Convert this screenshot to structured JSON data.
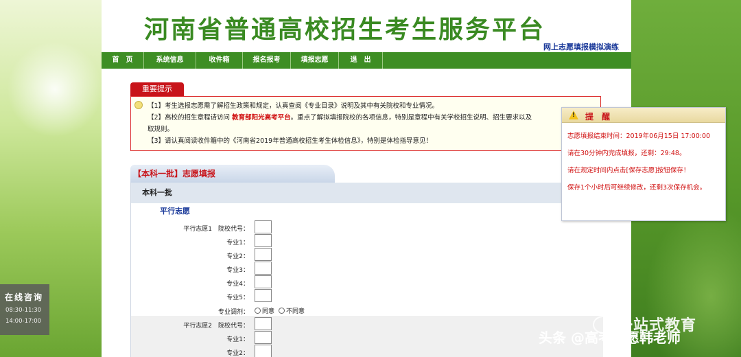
{
  "header": {
    "title": "河南省普通高校招生考生服务平台",
    "subtitle": "网上志愿填报模拟演练"
  },
  "nav": {
    "items": [
      {
        "label": "首　页"
      },
      {
        "label": "系统信息"
      },
      {
        "label": "收件箱"
      },
      {
        "label": "报名报考"
      },
      {
        "label": "填报志愿"
      },
      {
        "label": "退　出"
      }
    ]
  },
  "notice": {
    "tab_label": "重要提示",
    "line1": "【1】考生选报志愿需了解招生政策和规定，认真查阅《专业目录》说明及其中有关院校和专业情况。",
    "line2_pre": "【2】高校的招生章程请访问",
    "line2_link": "教育部阳光高考平台",
    "line2_post": "。重点了解拟填报院校的各项信息，特别是章程中有关学校招生说明、招生要求以及",
    "line2_cont": "取规则。",
    "line3": "【3】请认真阅读收件箱中的《河南省2019年普通高校招生考生体检信息》，特别是体检指导意见！"
  },
  "form": {
    "tab_label": "【本科一批】志愿填报",
    "category": "本科一批",
    "section": "平行志愿",
    "group1": {
      "school_label": "平行志愿1　院校代号：",
      "majors": [
        "专业1：",
        "专业2：",
        "专业3：",
        "专业4：",
        "专业5："
      ],
      "adjust_label": "专业调剂：",
      "options": [
        "同意",
        "不同意"
      ]
    },
    "group2": {
      "school_label": "平行志愿2　院校代号：",
      "majors": [
        "专业1：",
        "专业2："
      ]
    }
  },
  "popup": {
    "title": "提 醒",
    "lines": [
      "志愿填报结束时间：2019年06月15日 17:00:00",
      "请在30分钟内完成填报，还剩：29:48。",
      "请在规定时间内点击[保存志愿]按钮保存！",
      "保存1个小时后可继续修改，还剩3次保存机会。"
    ]
  },
  "consult": {
    "title": "在线咨询",
    "times": [
      "08:30-11:30",
      "14:00-17:00"
    ]
  },
  "watermark": {
    "brand": "一站式教育",
    "credit": "头条 @高考志愿韩老师"
  }
}
